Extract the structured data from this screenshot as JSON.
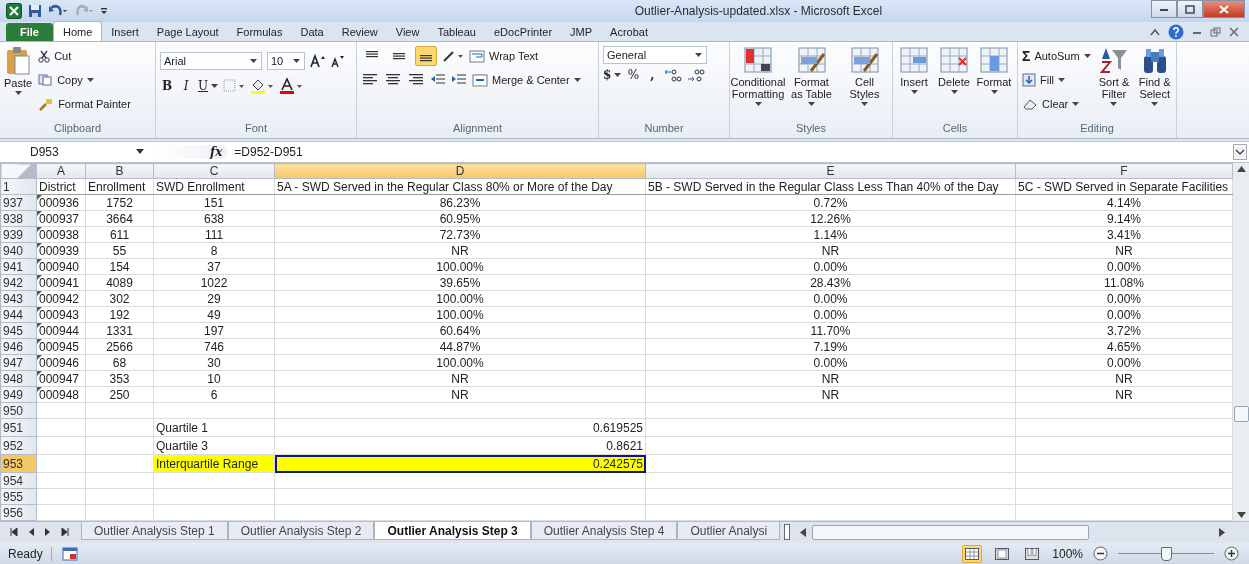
{
  "window": {
    "title": "Outlier-Analysis-updated.xlsx - Microsoft Excel"
  },
  "ribbon_tabs": [
    {
      "label": "File",
      "kind": "file",
      "selected": false
    },
    {
      "label": "Home",
      "kind": "tab",
      "selected": true
    },
    {
      "label": "Insert",
      "kind": "tab",
      "selected": false
    },
    {
      "label": "Page Layout",
      "kind": "tab",
      "selected": false
    },
    {
      "label": "Formulas",
      "kind": "tab",
      "selected": false
    },
    {
      "label": "Data",
      "kind": "tab",
      "selected": false
    },
    {
      "label": "Review",
      "kind": "tab",
      "selected": false
    },
    {
      "label": "View",
      "kind": "tab",
      "selected": false
    },
    {
      "label": "Tableau",
      "kind": "tab",
      "selected": false
    },
    {
      "label": "eDocPrinter",
      "kind": "tab",
      "selected": false
    },
    {
      "label": "JMP",
      "kind": "tab",
      "selected": false
    },
    {
      "label": "Acrobat",
      "kind": "tab",
      "selected": false
    }
  ],
  "ribbon_groups": [
    {
      "kind": "clipboard",
      "label": "Clipboard",
      "paste": "Paste",
      "cut": "Cut",
      "copy": "Copy",
      "format_painter": "Format Painter"
    },
    {
      "kind": "font",
      "label": "Font",
      "font_name": "Arial",
      "font_size": "10",
      "bold": "B",
      "italic": "I",
      "underline": "U"
    },
    {
      "kind": "alignment",
      "label": "Alignment",
      "wrap_text": "Wrap Text",
      "merge": "Merge & Center",
      "vertical_align": [
        {
          "selected": false
        },
        {
          "selected": false
        },
        {
          "selected": true
        }
      ]
    },
    {
      "kind": "number",
      "label": "Number",
      "format": "General",
      "currency": "$",
      "percent": "%",
      "comma": ","
    },
    {
      "kind": "styles",
      "label": "Styles",
      "buttons": [
        "Conditional Formatting",
        "Format as Table",
        "Cell Styles"
      ]
    },
    {
      "kind": "cells",
      "label": "Cells",
      "buttons": [
        "Insert",
        "Delete",
        "Format"
      ]
    },
    {
      "kind": "editing",
      "label": "Editing",
      "autosum_symbol": "Σ",
      "autosum": "AutoSum",
      "fill": "Fill",
      "clear": "Clear",
      "sort": "Sort & Filter",
      "find": "Find & Select"
    }
  ],
  "formula_bar": {
    "name_box": "D953",
    "fx": "fx",
    "formula": "=D952-D951"
  },
  "columns": [
    {
      "label": "A",
      "selected": false
    },
    {
      "label": "B",
      "selected": false
    },
    {
      "label": "C",
      "selected": false
    },
    {
      "label": "D",
      "selected": true
    },
    {
      "label": "E",
      "selected": false
    },
    {
      "label": "F",
      "selected": false
    }
  ],
  "rows": [
    {
      "number": "1",
      "kind": "header",
      "selected": false,
      "cells": [
        "District",
        "Enrollment",
        "SWD Enrollment",
        "5A - SWD Served in the Regular Class 80% or More of the Day",
        "5B - SWD Served in the Regular Class Less Than 40% of the Day",
        "5C - SWD Served in Separate Facilities"
      ]
    },
    {
      "number": "937",
      "kind": "data",
      "selected": false,
      "cells": [
        "000936",
        "1752",
        "151",
        "86.23%",
        "0.72%",
        "4.14%"
      ]
    },
    {
      "number": "938",
      "kind": "data",
      "selected": false,
      "cells": [
        "000937",
        "3664",
        "638",
        "60.95%",
        "12.26%",
        "9.14%"
      ]
    },
    {
      "number": "939",
      "kind": "data",
      "selected": false,
      "cells": [
        "000938",
        "611",
        "111",
        "72.73%",
        "1.14%",
        "3.41%"
      ]
    },
    {
      "number": "940",
      "kind": "data",
      "selected": false,
      "cells": [
        "000939",
        "55",
        "8",
        "NR",
        "NR",
        "NR"
      ]
    },
    {
      "number": "941",
      "kind": "data",
      "selected": false,
      "cells": [
        "000940",
        "154",
        "37",
        "100.00%",
        "0.00%",
        "0.00%"
      ]
    },
    {
      "number": "942",
      "kind": "data",
      "selected": false,
      "cells": [
        "000941",
        "4089",
        "1022",
        "39.65%",
        "28.43%",
        "11.08%"
      ]
    },
    {
      "number": "943",
      "kind": "data",
      "selected": false,
      "cells": [
        "000942",
        "302",
        "29",
        "100.00%",
        "0.00%",
        "0.00%"
      ]
    },
    {
      "number": "944",
      "kind": "data",
      "selected": false,
      "cells": [
        "000943",
        "192",
        "49",
        "100.00%",
        "0.00%",
        "0.00%"
      ]
    },
    {
      "number": "945",
      "kind": "data",
      "selected": false,
      "cells": [
        "000944",
        "1331",
        "197",
        "60.64%",
        "11.70%",
        "3.72%"
      ]
    },
    {
      "number": "946",
      "kind": "data",
      "selected": false,
      "cells": [
        "000945",
        "2566",
        "746",
        "44.87%",
        "7.19%",
        "4.65%"
      ]
    },
    {
      "number": "947",
      "kind": "data",
      "selected": false,
      "cells": [
        "000946",
        "68",
        "30",
        "100.00%",
        "0.00%",
        "0.00%"
      ]
    },
    {
      "number": "948",
      "kind": "data",
      "selected": false,
      "cells": [
        "000947",
        "353",
        "10",
        "NR",
        "NR",
        "NR"
      ]
    },
    {
      "number": "949",
      "kind": "data",
      "selected": false,
      "cells": [
        "000948",
        "250",
        "6",
        "NR",
        "NR",
        "NR"
      ]
    },
    {
      "number": "950",
      "kind": "empty",
      "selected": false
    },
    {
      "number": "951",
      "kind": "summary",
      "selected": false,
      "cells": [
        null,
        null,
        "Quartile 1",
        "0.619525"
      ]
    },
    {
      "number": "952",
      "kind": "summary",
      "selected": false,
      "cells": [
        null,
        null,
        "Quartile 3",
        "0.8621"
      ]
    },
    {
      "number": "953",
      "kind": "summary",
      "selected": true,
      "highlighted": true,
      "cells": [
        null,
        null,
        "Interquartile Range",
        "0.242575"
      ]
    },
    {
      "number": "954",
      "kind": "empty",
      "selected": false
    },
    {
      "number": "955",
      "kind": "empty",
      "selected": false
    },
    {
      "number": "956",
      "kind": "empty",
      "selected": false
    }
  ],
  "sheet_tabs": [
    {
      "label": "Outlier Analysis Step 1",
      "selected": false
    },
    {
      "label": "Outlier Analysis Step 2",
      "selected": false
    },
    {
      "label": "Outlier Analysis Step 3",
      "selected": true
    },
    {
      "label": "Outlier Analysis Step 4",
      "selected": false
    },
    {
      "label": "Outlier Analysi",
      "selected": false
    }
  ],
  "status_bar": {
    "status": "Ready",
    "zoom": "100%",
    "zoom_slider": {
      "level": 0.5
    }
  }
}
